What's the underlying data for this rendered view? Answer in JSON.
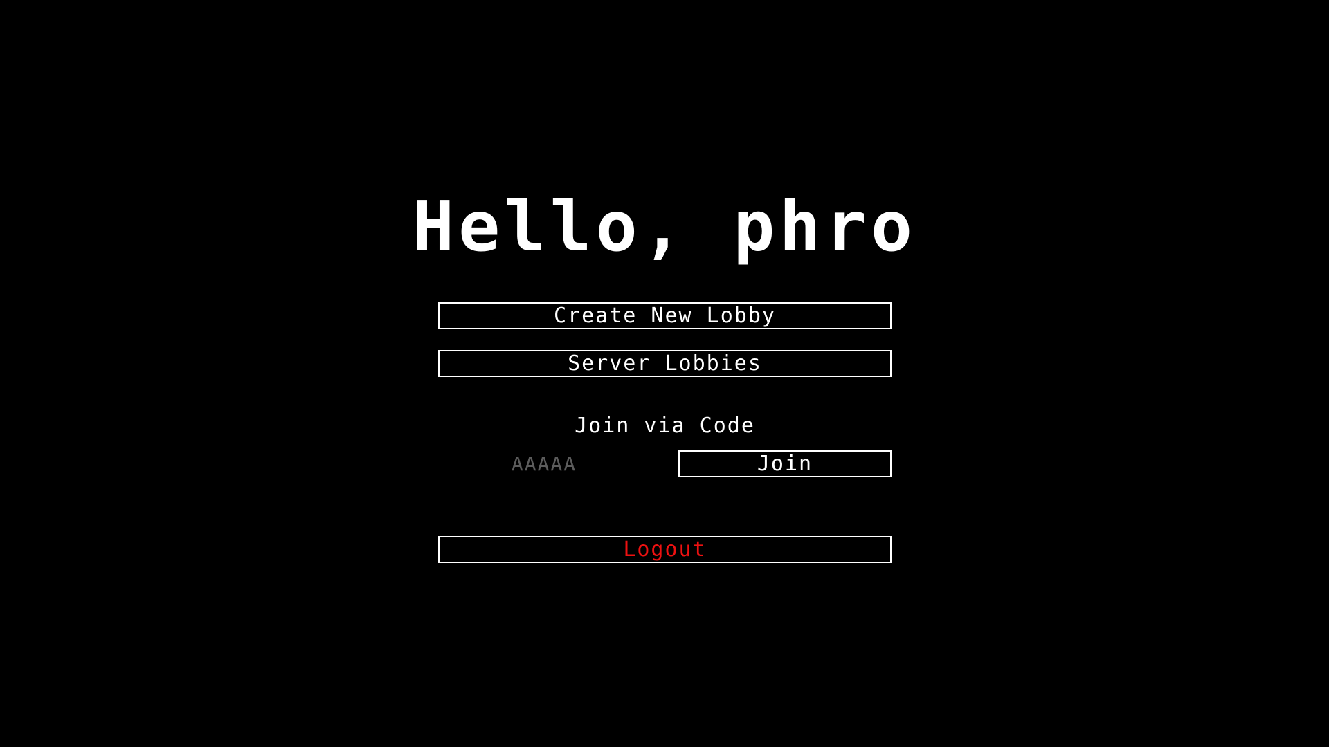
{
  "greeting": "Hello, phro",
  "menu": {
    "create_label": "Create New Lobby",
    "server_label": "Server Lobbies",
    "join_section_label": "Join via Code",
    "code_placeholder": "AAAAA",
    "code_value": "",
    "join_label": "Join",
    "logout_label": "Logout"
  },
  "colors": {
    "background": "#000000",
    "text": "#ffffff",
    "logout": "#ee1111",
    "placeholder": "#5c5c5c"
  }
}
